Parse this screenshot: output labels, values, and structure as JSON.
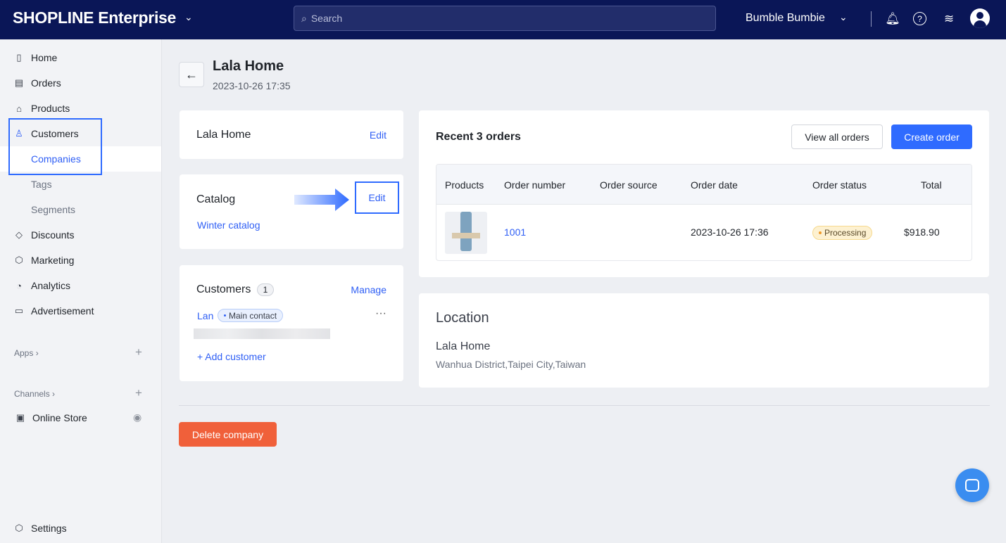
{
  "header": {
    "brand": "SHOPLINE Enterprise",
    "search_placeholder": "Search",
    "store_name": "Bumble Bumbie"
  },
  "sidebar": {
    "items": [
      {
        "label": "Home",
        "icon": "home-icon"
      },
      {
        "label": "Orders",
        "icon": "orders-icon"
      },
      {
        "label": "Products",
        "icon": "bag-icon"
      },
      {
        "label": "Customers",
        "icon": "user-icon"
      },
      {
        "label": "Companies"
      },
      {
        "label": "Tags"
      },
      {
        "label": "Segments"
      },
      {
        "label": "Discounts",
        "icon": "tag-icon"
      },
      {
        "label": "Marketing",
        "icon": "box-icon"
      },
      {
        "label": "Analytics",
        "icon": "pie-icon"
      },
      {
        "label": "Advertisement",
        "icon": "ad-icon"
      }
    ],
    "apps_label": "Apps",
    "channels_label": "Channels",
    "online_store": "Online Store",
    "settings": "Settings"
  },
  "page": {
    "title": "Lala Home",
    "date": "2023-10-26 17:35"
  },
  "company_card": {
    "name": "Lala Home",
    "edit": "Edit"
  },
  "catalog_card": {
    "title": "Catalog",
    "edit": "Edit",
    "catalog": "Winter catalog"
  },
  "customers_card": {
    "title": "Customers",
    "count": "1",
    "manage": "Manage",
    "customer": "Lan",
    "tag": "Main contact",
    "add": "+ Add customer"
  },
  "orders": {
    "title": "Recent 3 orders",
    "view_all": "View all orders",
    "create": "Create order",
    "columns": [
      "Products",
      "Order number",
      "Order source",
      "Order date",
      "Order status",
      "Total"
    ],
    "rows": [
      {
        "number": "1001",
        "source": "",
        "date": "2023-10-26 17:36",
        "status": "Processing",
        "total": "$918.90"
      }
    ]
  },
  "location": {
    "title": "Location",
    "name": "Lala Home",
    "address": "Wanhua District,Taipei City,Taiwan"
  },
  "delete_label": "Delete company",
  "colors": {
    "accent": "#2f5ff5",
    "topbar": "#0a1657",
    "danger": "#f0603a"
  }
}
